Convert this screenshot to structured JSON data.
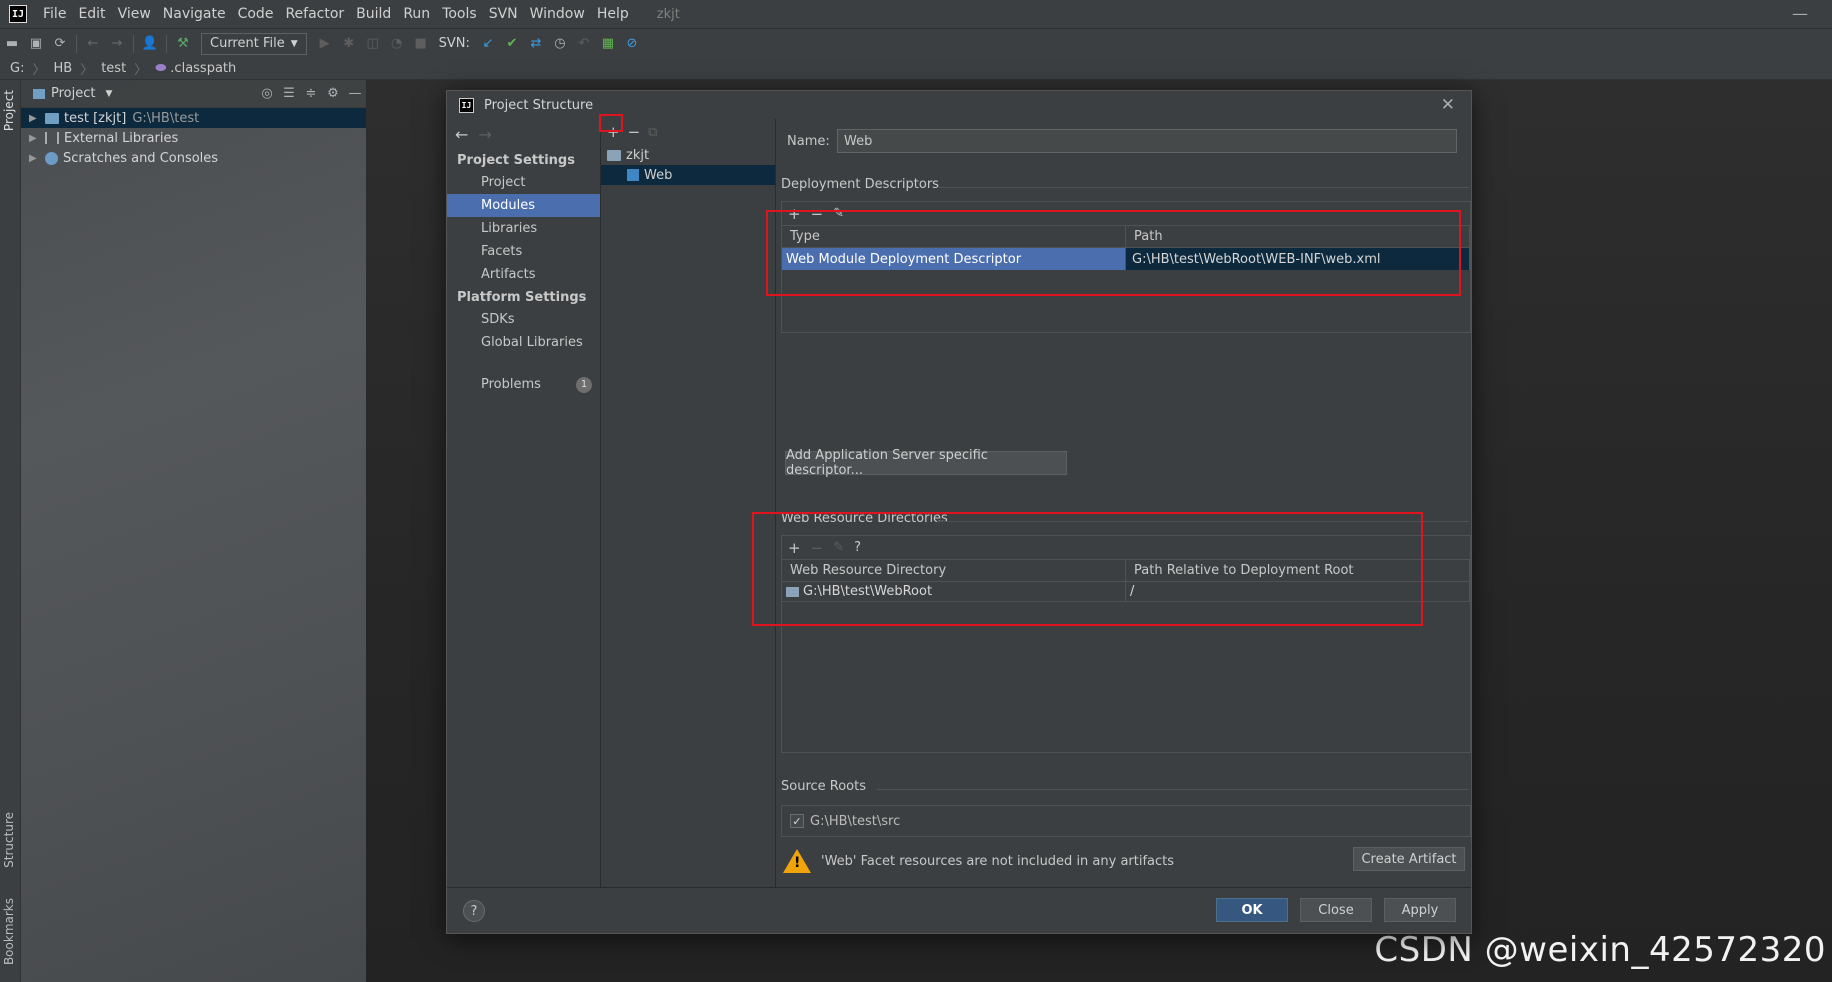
{
  "menubar": {
    "logo": "IJ",
    "items": [
      "File",
      "Edit",
      "View",
      "Navigate",
      "Code",
      "Refactor",
      "Build",
      "Run",
      "Tools",
      "SVN",
      "Window",
      "Help"
    ],
    "project_name": "zkjt",
    "minimize": "—"
  },
  "toolbar": {
    "run_config": "Current File",
    "svn_label": "SVN:"
  },
  "breadcrumb": [
    "G:",
    "HB",
    "test",
    ".classpath"
  ],
  "left_strip": {
    "tabs": [
      "Project",
      "Structure",
      "Bookmarks"
    ]
  },
  "project_panel": {
    "title": "Project",
    "tree": [
      {
        "label": "test [zkjt]",
        "path": "G:\\HB\\test",
        "selected": true
      },
      {
        "label": "External Libraries",
        "path": ""
      },
      {
        "label": "Scratches and Consoles",
        "path": ""
      }
    ]
  },
  "dialog": {
    "title": "Project Structure",
    "logo": "IJ",
    "close": "✕",
    "nav": {
      "project_settings_header": "Project Settings",
      "project_settings": [
        "Project",
        "Modules",
        "Libraries",
        "Facets",
        "Artifacts"
      ],
      "active": "Modules",
      "platform_settings_header": "Platform Settings",
      "platform_settings": [
        "SDKs",
        "Global Libraries"
      ],
      "problems_label": "Problems",
      "problems_count": "1"
    },
    "modules": {
      "root": "zkjt",
      "child": "Web"
    },
    "content": {
      "name_label": "Name:",
      "name_value": "Web",
      "deployment_descriptors_title": "Deployment Descriptors",
      "dd_columns": [
        "Type",
        "Path"
      ],
      "dd_rows": [
        {
          "type": "Web Module Deployment Descriptor",
          "path": "G:\\HB\\test\\WebRoot\\WEB-INF\\web.xml"
        }
      ],
      "add_server_descriptor_button": "Add Application Server specific descriptor...",
      "web_resource_title": "Web Resource Directories",
      "wr_columns": [
        "Web Resource Directory",
        "Path Relative to Deployment Root"
      ],
      "wr_rows": [
        {
          "directory": "G:\\HB\\test\\WebRoot",
          "relative": "/"
        }
      ],
      "source_roots_title": "Source Roots",
      "source_root": "G:\\HB\\test\\src",
      "source_root_checked": true,
      "warning_text": "'Web' Facet resources are not included in any artifacts",
      "create_artifact_button": "Create Artifact"
    },
    "footer": {
      "help": "?",
      "ok": "OK",
      "close": "Close",
      "apply": "Apply"
    }
  },
  "watermark": "CSDN @weixin_42572320",
  "colors": {
    "accent_selection": "#4b6eaf",
    "dark_selection": "#0d293e",
    "annotation_red": "#e0141e",
    "warning": "#f0a30a"
  }
}
